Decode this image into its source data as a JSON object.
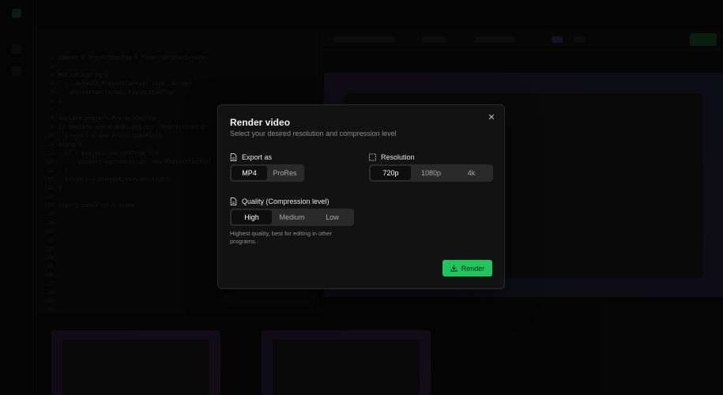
{
  "background": {
    "code_lines": [
      "import { ProjectConfig } from '@project/core'",
      "",
      "Motion.config {",
      "  ...default.ProjectConfig( size, dc-go)",
      "  .set(variant=true, ProjectConfig)",
      "}",
      "",
      "declare.project.ProjectConfig",
      "// declare.scene.d001.001.scr 'ProjectConfig'",
      "  project = new ProjectConfig()",
      "scene {",
      "  if ( project.variantTrue ) {",
      "      project.variant(true, new ProjectConfig)",
      "  }",
      "  project = project.variant(true)",
      "}",
      "",
      "export const id = scene"
    ],
    "line_numbers": [
      "1",
      "2",
      "3",
      "4",
      "5",
      "6",
      "7",
      "8",
      "9",
      "10",
      "11",
      "12",
      "13",
      "14",
      "15",
      "16",
      "17",
      "18",
      "19",
      "20",
      "21",
      "22",
      "23",
      "24",
      "25",
      "26",
      "27",
      "28",
      "29",
      "30"
    ]
  },
  "modal": {
    "title": "Render video",
    "subtitle": "Select your desired resolution and compression level",
    "export": {
      "label": "Export as",
      "icon": "file-icon",
      "options": [
        "MP4",
        "ProRes"
      ],
      "selected": "MP4"
    },
    "resolution": {
      "label": "Resolution",
      "icon": "dashed-square-icon",
      "options": [
        "720p",
        "1080p",
        "4k"
      ],
      "selected": "720p"
    },
    "quality": {
      "label": "Quality (Compression level)",
      "icon": "file-icon",
      "options": [
        "High",
        "Medium",
        "Low"
      ],
      "selected": "High",
      "hint": "Highest quality, best for editing in other programs."
    },
    "render_button": "Render",
    "close_icon": "close-icon"
  },
  "colors": {
    "accent": "#21c55d",
    "modal_bg": "#121212",
    "segment_bg": "#2a2a2a"
  }
}
